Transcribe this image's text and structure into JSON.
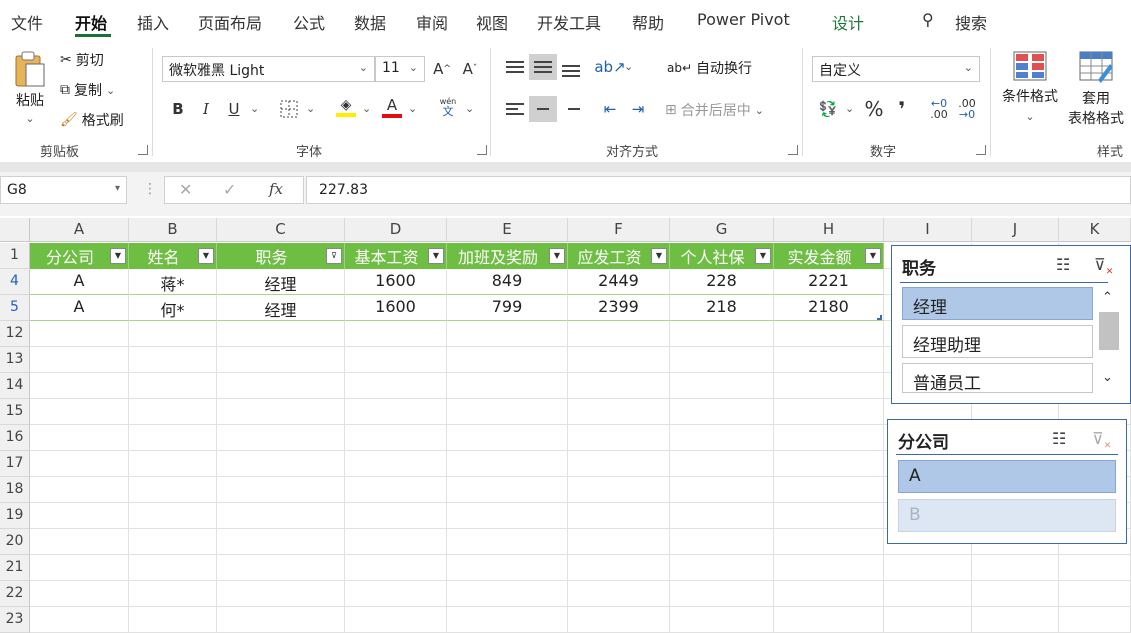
{
  "menu": {
    "tabs": [
      "文件",
      "开始",
      "插入",
      "页面布局",
      "公式",
      "数据",
      "审阅",
      "视图",
      "开发工具",
      "帮助",
      "Power Pivot",
      "设计"
    ],
    "search_label": "搜索"
  },
  "ribbon": {
    "clipboard": {
      "paste": "粘贴",
      "cut": "剪切",
      "copy": "复制",
      "format_painter": "格式刷",
      "label": "剪贴板"
    },
    "font": {
      "name": "微软雅黑 Light",
      "size": "11",
      "bold": "B",
      "italic": "I",
      "underline": "U",
      "phonetic_top": "wén",
      "phonetic_bottom": "文",
      "label": "字体"
    },
    "alignment": {
      "wrap": "自动换行",
      "merge": "合并后居中",
      "label": "对齐方式"
    },
    "number": {
      "format": "自定义",
      "percent": "%",
      "comma": "❜",
      "inc_decimal": ".00",
      "dec_decimal": ".00",
      "label": "数字"
    },
    "styles": {
      "conditional": "条件格式",
      "table_format_line1": "套用",
      "table_format_line2": "表格格式",
      "label": "样式"
    }
  },
  "formula_bar": {
    "name_box": "G8",
    "fx": "fx",
    "value": "227.83"
  },
  "columns": [
    "A",
    "B",
    "C",
    "D",
    "E",
    "F",
    "G",
    "H",
    "I",
    "J",
    "K"
  ],
  "table": {
    "header_row_num": "1",
    "headers": [
      "分公司",
      "姓名",
      "职务",
      "基本工资",
      "加班及奖励",
      "应发工资",
      "个人社保",
      "实发金额"
    ],
    "rows": [
      {
        "row_num": "4",
        "cells": [
          "A",
          "蒋*",
          "经理",
          "1600",
          "849",
          "2449",
          "228",
          "2221"
        ]
      },
      {
        "row_num": "5",
        "cells": [
          "A",
          "何*",
          "经理",
          "1600",
          "799",
          "2399",
          "218",
          "2180"
        ]
      }
    ]
  },
  "empty_rows": [
    "12",
    "13",
    "14",
    "15",
    "16",
    "17",
    "18",
    "19",
    "20",
    "21",
    "22",
    "23"
  ],
  "slicers": {
    "position": {
      "title": "职务",
      "items": [
        {
          "label": "经理",
          "state": "selected"
        },
        {
          "label": "经理助理",
          "state": "normal"
        },
        {
          "label": "普通员工",
          "state": "normal"
        }
      ]
    },
    "branch": {
      "title": "分公司",
      "items": [
        {
          "label": "A",
          "state": "selected"
        },
        {
          "label": "B",
          "state": "nodata"
        }
      ]
    }
  }
}
